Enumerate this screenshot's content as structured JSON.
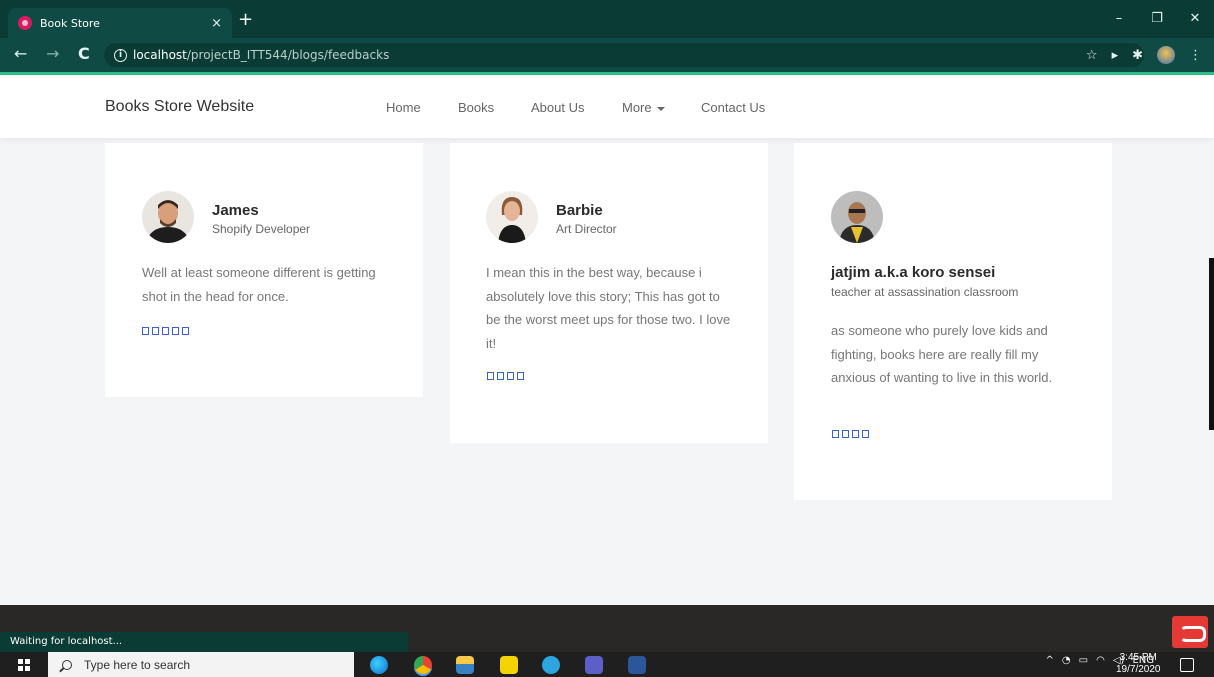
{
  "browser": {
    "tab_title": "Book Store",
    "tab_close": "×",
    "new_tab": "+",
    "window_controls": [
      "–",
      "❐",
      "✕"
    ],
    "url_host": "localhost",
    "url_path": "/projectB_ITT544/blogs/feedbacks",
    "status_text": "Waiting for localhost..."
  },
  "site": {
    "brand": "Books Store Website",
    "nav": [
      "Home",
      "Books",
      "About Us",
      "More",
      "Contact Us"
    ]
  },
  "testimonials": [
    {
      "name": "James",
      "role": "Shopify Developer",
      "quote": "Well at least someone different is getting shot in the head for once.",
      "stars": 5
    },
    {
      "name": "Barbie",
      "role": "Art Director",
      "quote": "I mean this in the best way, because i absolutely love this story; This has got to be the worst meet ups for those two. I love it!",
      "stars": 4
    },
    {
      "name": "jatjim a.k.a koro sensei",
      "role": "teacher at assassination classroom",
      "quote": "as someone who purely love kids and fighting, books here are really fill my anxious of wanting to live in this world.",
      "stars": 4
    }
  ],
  "taskbar": {
    "search_placeholder": "Type here to search",
    "language": "ENG",
    "time": "3:45 PM",
    "date": "19/7/2020"
  },
  "colors": {
    "browser_dark": "#0b3b35",
    "accent": "#2bbf8a",
    "star": "#3a5fcf"
  }
}
